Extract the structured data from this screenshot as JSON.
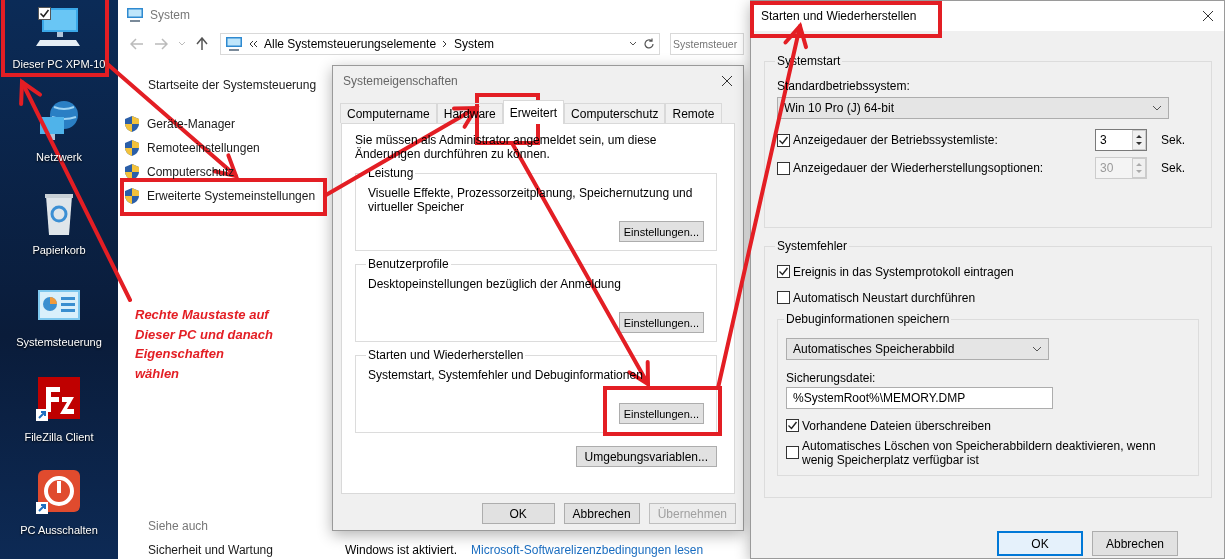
{
  "desktop": {
    "icons": [
      {
        "label": "Dieser PC XPM-10",
        "kind": "computer",
        "selected": true
      },
      {
        "label": "Netzwerk",
        "kind": "network",
        "selected": false
      },
      {
        "label": "Papierkorb",
        "kind": "recycle",
        "selected": false
      },
      {
        "label": "Systemsteuerung",
        "kind": "control",
        "selected": false
      },
      {
        "label": "FileZilla Client",
        "kind": "filezilla",
        "selected": false
      },
      {
        "label": "PC Ausschalten",
        "kind": "power",
        "selected": false
      }
    ]
  },
  "system_window": {
    "title": "System",
    "address": [
      "Alle Systemsteuerungselemente",
      "System"
    ],
    "search_placeholder": "Systemsteuer",
    "home_link": "Startseite der Systemsteuerung",
    "tasks": [
      "Geräte-Manager",
      "Remoteeinstellungen",
      "Computerschutz",
      "Erweiterte Systemeinstellungen"
    ],
    "see_also_heading": "Siehe auch",
    "see_also": [
      "Sicherheit und Wartung"
    ],
    "activation_status": "Windows ist aktiviert.",
    "license_link": "Microsoft-Softwarelizenzbedingungen lesen"
  },
  "properties_dialog": {
    "title": "Systemeigenschaften",
    "tabs": [
      {
        "label": "Computername",
        "selected": false
      },
      {
        "label": "Hardware",
        "selected": false
      },
      {
        "label": "Erweitert",
        "selected": true
      },
      {
        "label": "Computerschutz",
        "selected": false
      },
      {
        "label": "Remote",
        "selected": false
      }
    ],
    "notice": "Sie müssen als Administrator angemeldet sein, um diese Änderungen durchführen zu können.",
    "groups": [
      {
        "title": "Leistung",
        "description": "Visuelle Effekte, Prozessorzeitplanung, Speichernutzung und virtueller Speicher",
        "button": "Einstellungen..."
      },
      {
        "title": "Benutzerprofile",
        "description": "Desktopeinstellungen bezüglich der Anmeldung",
        "button": "Einstellungen..."
      },
      {
        "title": "Starten und Wiederherstellen",
        "description": "Systemstart, Systemfehler und Debuginformationen",
        "button": "Einstellungen..."
      }
    ],
    "env_button": "Umgebungsvariablen...",
    "buttons": [
      {
        "label": "OK",
        "disabled": false
      },
      {
        "label": "Abbrechen",
        "disabled": false
      },
      {
        "label": "Übernehmen",
        "disabled": true
      }
    ]
  },
  "startup_dialog": {
    "title": "Starten und Wiederherstellen",
    "startup_group": {
      "title": "Systemstart",
      "os_label": "Standardbetriebssystem:",
      "os_value": "Win 10  Pro (J) 64-bit",
      "timeouts": [
        {
          "label": "Anzeigedauer der Betriebssystemliste:",
          "checked": true,
          "value": "3",
          "unit": "Sek."
        },
        {
          "label": "Anzeigedauer der Wiederherstellungsoptionen:",
          "checked": false,
          "value": "30",
          "unit": "Sek."
        }
      ]
    },
    "failure_group": {
      "title": "Systemfehler",
      "options": [
        {
          "label": "Ereignis in das Systemprotokoll eintragen",
          "checked": true
        },
        {
          "label": "Automatisch Neustart durchführen",
          "checked": false
        }
      ],
      "debug_group": {
        "title": "Debuginformationen speichern",
        "dump_type": "Automatisches Speicherabbild",
        "file_label": "Sicherungsdatei:",
        "file_value": "%SystemRoot%\\MEMORY.DMP",
        "options": [
          {
            "label": "Vorhandene Dateien überschreiben",
            "checked": true
          },
          {
            "label": "Automatisches Löschen von Speicherabbildern deaktivieren, wenn wenig Speicherplatz verfügbar ist",
            "checked": false
          }
        ]
      }
    },
    "buttons": [
      {
        "label": "OK",
        "default": true
      },
      {
        "label": "Abbrechen",
        "default": false
      }
    ]
  },
  "annotation": {
    "note": "Rechte Maustaste auf\nDieser PC und danach\nEigenschaften\nwählen"
  }
}
